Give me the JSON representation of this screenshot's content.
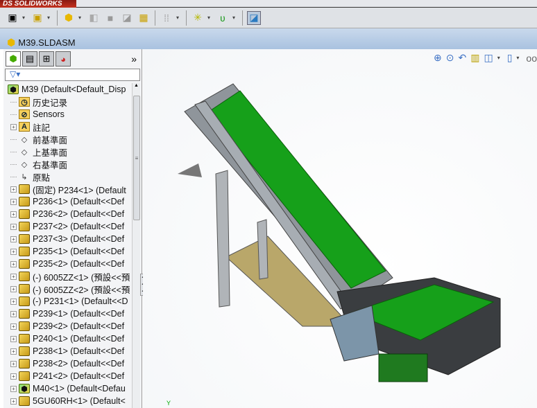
{
  "app": {
    "logo_text": "SOLIDWORKS"
  },
  "document": {
    "title": "M39.SLDASM"
  },
  "panel": {
    "more_label": "»",
    "filter_icon": "funnel-icon",
    "tree": [
      {
        "label": "M39  (Default<Default_Disp",
        "icon": "assembly",
        "expand": false,
        "root": true
      },
      {
        "label": "历史记录",
        "icon": "history",
        "expand": false
      },
      {
        "label": "Sensors",
        "icon": "sensors",
        "expand": false
      },
      {
        "label": "註記",
        "icon": "annotations",
        "expand": true
      },
      {
        "label": "前基準面",
        "icon": "plane",
        "expand": false
      },
      {
        "label": "上基準面",
        "icon": "plane",
        "expand": false
      },
      {
        "label": "右基準面",
        "icon": "plane",
        "expand": false
      },
      {
        "label": "原點",
        "icon": "origin",
        "expand": false
      },
      {
        "label": "(固定) P234<1> (Default",
        "icon": "part",
        "expand": true
      },
      {
        "label": "P236<1> (Default<<Def",
        "icon": "part",
        "expand": true
      },
      {
        "label": "P236<2> (Default<<Def",
        "icon": "part",
        "expand": true
      },
      {
        "label": "P237<2> (Default<<Def",
        "icon": "part",
        "expand": true
      },
      {
        "label": "P237<3> (Default<<Def",
        "icon": "part",
        "expand": true
      },
      {
        "label": "P235<1> (Default<<Def",
        "icon": "part",
        "expand": true
      },
      {
        "label": "P235<2> (Default<<Def",
        "icon": "part",
        "expand": true
      },
      {
        "label": "(-) 6005ZZ<1> (預設<<預",
        "icon": "part",
        "expand": true
      },
      {
        "label": "(-) 6005ZZ<2> (預設<<預",
        "icon": "part",
        "expand": true
      },
      {
        "label": "(-) P231<1> (Default<<D",
        "icon": "part",
        "expand": true
      },
      {
        "label": "P239<1> (Default<<Def",
        "icon": "part",
        "expand": true
      },
      {
        "label": "P239<2> (Default<<Def",
        "icon": "part",
        "expand": true
      },
      {
        "label": "P240<1> (Default<<Def",
        "icon": "part",
        "expand": true
      },
      {
        "label": "P238<1> (Default<<Def",
        "icon": "part",
        "expand": true
      },
      {
        "label": "P238<2> (Default<<Def",
        "icon": "part",
        "expand": true
      },
      {
        "label": "P241<2> (Default<<Def",
        "icon": "part",
        "expand": true
      },
      {
        "label": "M40<1> (Default<Defau",
        "icon": "assembly",
        "expand": true
      },
      {
        "label": "5GU60RH<1> (Default<",
        "icon": "part",
        "expand": true
      }
    ]
  },
  "viewport": {
    "axis_label": "Y"
  }
}
